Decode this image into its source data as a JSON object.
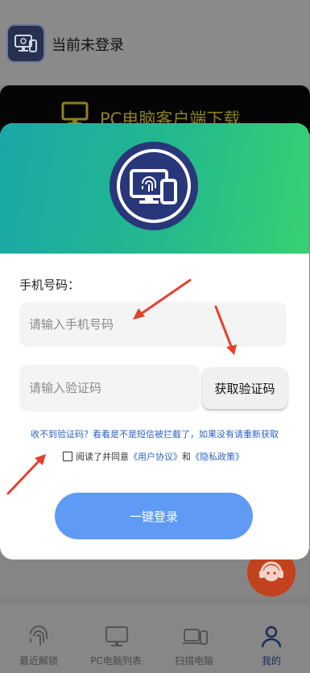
{
  "app_header": {
    "login_status": "当前未登录",
    "logo_icon": "fingerprint-monitor-icon"
  },
  "download_banner": {
    "text": "PC电脑客户端下载",
    "icon": "monitor-icon"
  },
  "login_modal": {
    "logo_icon": "fingerprint-monitor-phone-icon",
    "phone_label": "手机号码：",
    "phone_placeholder": "请输入手机号码",
    "code_placeholder": "请输入验证码",
    "get_code_label": "获取验证码",
    "hint": "收不到验证码？看看是不是短信被拦截了，如果没有请重新获取",
    "agree": {
      "prefix": "阅读了并同意",
      "user_agreement": "《用户协议》",
      "and": "和",
      "privacy_policy": "《隐私政策》",
      "checked": false
    },
    "login_button": "一键登录",
    "colors": {
      "header_start": "#19a8a8",
      "header_end": "#37d172",
      "button": "#5f9bf5",
      "link": "#2b63c4"
    }
  },
  "tabbar": {
    "items": [
      {
        "label": "最近解锁",
        "icon": "fingerprint-icon"
      },
      {
        "label": "PC电脑列表",
        "icon": "monitor-icon"
      },
      {
        "label": "扫描电脑",
        "icon": "devices-icon"
      },
      {
        "label": "我的",
        "icon": "user-icon",
        "active": true
      }
    ]
  },
  "help_button": {
    "icon": "headset-support-icon"
  },
  "annotation_color": "#e2412c"
}
